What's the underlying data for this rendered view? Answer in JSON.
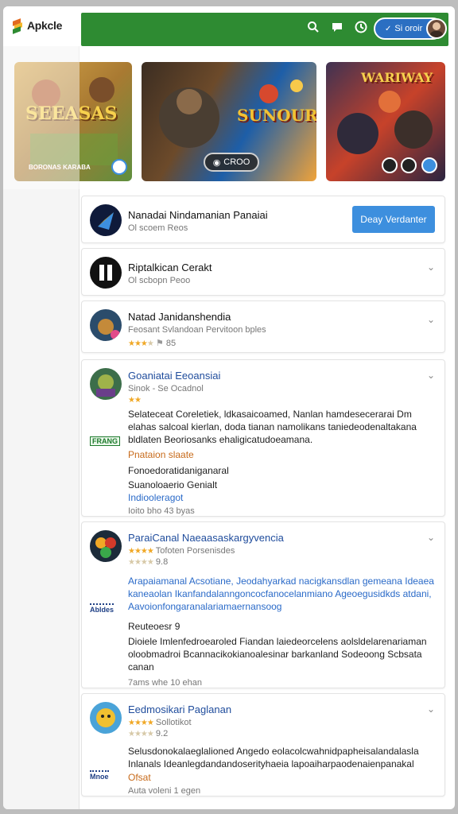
{
  "header": {
    "logo_text": "Apkcle",
    "signin_label": "Si oroir",
    "icons": [
      "search-icon",
      "chat-icon",
      "refresh-icon",
      "user-avatar"
    ]
  },
  "banners": [
    {
      "title": "SEEASAS",
      "subtitle": "BORONAS KARABA"
    },
    {
      "title": "SUNOURS",
      "play_label": "CROO"
    },
    {
      "title": "WARIWAY"
    }
  ],
  "cards": [
    {
      "title": "Nanadai Nindamanian Panaiai",
      "sub": "Ol scoem Reos",
      "button": "Deay Verdanter"
    },
    {
      "title": "Riptalkican Cerakt",
      "sub": "Ol scbopn Peoo"
    },
    {
      "title": "Natad Janidanshendia",
      "sub": "Feosant Svlandoan Pervitoon bples",
      "rating": "85"
    },
    {
      "title": "Goaniatai Eeoansiai",
      "sub": "Sinok - Se Ocadnol",
      "desc": "Selateceat Coreletiek, ldkasaicoamed, Nanlan hamdesecerarai Dm elahas salcoal kierlan, doda tianan namolikans taniedeodenaltakana bldlaten Beoriosanks ehaligicatudoeamana.",
      "badge": "FRANG",
      "line_orange": "Pnataion slaate",
      "line1": "Fonoedoratidaniganaral",
      "line2": "Suanoloaerio Genialt",
      "line_blue": "Indiooleragot",
      "meta": "Ioito bho 43 byas"
    },
    {
      "title": "ParaiCanal Naeaasaskargyvencia",
      "sub": "Tofoten Porsenisdes",
      "rating": "9.8",
      "desc": "Arapaiamanal Acsotiane, Jeodahyarkad nacigkansdlan gemeana Ideaea kaneaolan Ikanfandalanngoncocfanocelanmiano Ageoegusidkds atdani, Aavoionfongaranalariamaernansoog",
      "badge": "Abldes",
      "line1": "Reuteoesr 9",
      "desc2": "Dioiele Imlenfedroearoled Fiandan laiedeorcelens aolsldelarenariaman oloobmadroi Bcannacikokianoalesinar barkanland Sodeoong Scbsata canan",
      "meta": "7ams whe 10 ehan"
    },
    {
      "title": "Eedmosikari Paglanan",
      "sub": "Sollotikot",
      "rating": "9.2",
      "desc": "Selusdonokalaeglalioned Angedo eolacolcwahnidpapheisalandalasla Inlanals Ideanlegdandandoserityhaeia lapoaiharpaodenaienpanakal",
      "badge": "Mnoe",
      "line_orange": "Ofsat",
      "meta": "Auta voleni 1 egen"
    }
  ],
  "colors": {
    "header_green": "#2e8b32",
    "install_blue": "#3d8fde",
    "link_blue": "#2a6ac8",
    "star_orange": "#f0a826"
  }
}
